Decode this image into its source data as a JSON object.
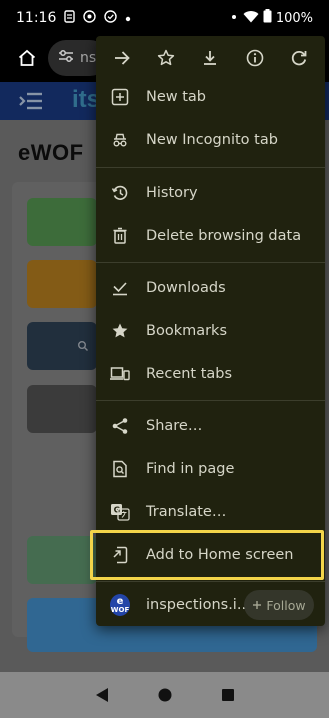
{
  "status_bar": {
    "time": "11:16",
    "battery": "100%",
    "icons": [
      "sim-icon",
      "location-icon",
      "check-circle-icon",
      "dot-icon",
      "signal-icon",
      "wifi-icon",
      "battery-icon"
    ]
  },
  "browser": {
    "url_fragment": "ns",
    "icons": [
      "home-icon",
      "site-settings-icon"
    ]
  },
  "page": {
    "logo_text": "its",
    "title": "eWOF",
    "tile_colors": [
      "#5ea65a",
      "#c98d22",
      "#34495e",
      "#5b5b5b",
      "#6aa67c",
      "#4a9fe0"
    ]
  },
  "menu": {
    "toolbar_icons": [
      "forward-icon",
      "bookmark-star-icon",
      "download-icon",
      "info-icon",
      "refresh-icon"
    ],
    "items": [
      {
        "label": "New tab",
        "icon": "new-tab-icon"
      },
      {
        "label": "New Incognito tab",
        "icon": "incognito-icon"
      },
      {
        "label": "History",
        "icon": "history-icon"
      },
      {
        "label": "Delete browsing data",
        "icon": "trash-icon"
      },
      {
        "label": "Downloads",
        "icon": "downloads-icon"
      },
      {
        "label": "Bookmarks",
        "icon": "bookmarks-star-icon"
      },
      {
        "label": "Recent tabs",
        "icon": "recent-tabs-icon"
      },
      {
        "label": "Share…",
        "icon": "share-icon"
      },
      {
        "label": "Find in page",
        "icon": "find-in-page-icon"
      },
      {
        "label": "Translate…",
        "icon": "translate-icon"
      },
      {
        "label": "Add to Home screen",
        "icon": "add-to-home-icon"
      }
    ],
    "site": {
      "label": "inspections.i...",
      "badge_top": "e",
      "badge_bottom": "WOF",
      "follow_label": "Follow"
    },
    "highlight_color": "#f3d54a"
  },
  "nav": {
    "icons": [
      "back-triangle-icon",
      "home-circle-icon",
      "recents-square-icon"
    ]
  }
}
